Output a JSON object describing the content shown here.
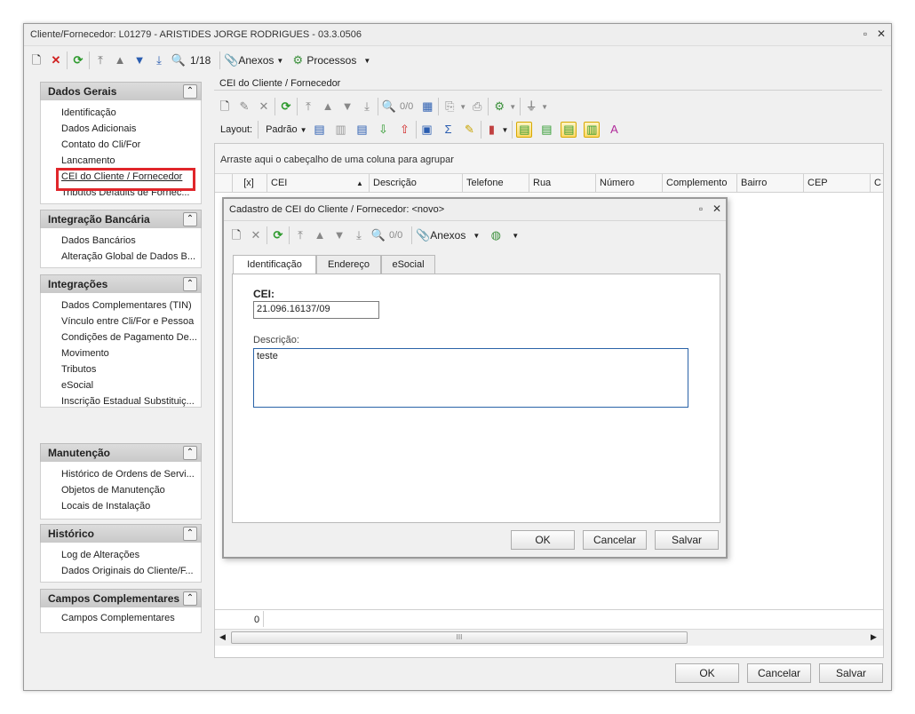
{
  "window": {
    "title": "Cliente/Fornecedor: L01279 - ARISTIDES JORGE RODRIGUES - 03.3.0506"
  },
  "main_toolbar": {
    "record_counter": "1/18",
    "attachments_label": "Anexos",
    "processes_label": "Processos"
  },
  "sidebar": {
    "panels": [
      {
        "title": "Dados Gerais",
        "items": [
          "Identificação",
          "Dados Adicionais",
          "Contato do Cli/For",
          "Lancamento",
          "CEI do Cliente / Fornecedor",
          "Tributos Defaults de Fornec..."
        ]
      },
      {
        "title": "Integração Bancária",
        "items": [
          "Dados Bancários",
          "Alteração Global de Dados B..."
        ]
      },
      {
        "title": "Integrações",
        "items": [
          "Dados Complementares (TIN)",
          "Vínculo entre Cli/For e Pessoa",
          "Condições de Pagamento De...",
          "Movimento",
          "Tributos",
          "eSocial",
          "Inscrição Estadual Substituiç..."
        ]
      },
      {
        "title": "Manutenção",
        "items": [
          "Histórico de Ordens de Servi...",
          "Objetos de Manutenção",
          "Locais de Instalação"
        ]
      },
      {
        "title": "Histórico",
        "items": [
          "Log de Alterações",
          "Dados Originais do Cliente/F..."
        ]
      },
      {
        "title": "Campos Complementares",
        "items": [
          "Campos Complementares"
        ]
      }
    ],
    "selected_item": "CEI do Cliente / Fornecedor"
  },
  "content": {
    "title": "CEI do Cliente /  Fornecedor",
    "toolbar": {
      "record_counter": "0/0"
    },
    "layout_bar": {
      "layout_label": "Layout:",
      "layout_value": "Padrão"
    },
    "group_hint": "Arraste aqui o cabeçalho de uma coluna para agrupar",
    "columns": [
      "[x]",
      "CEI",
      "Descrição",
      "Telefone",
      "Rua",
      "Número",
      "Complemento",
      "Bairro",
      "CEP",
      "C"
    ],
    "footer_count": "0",
    "scroll_thumb": "III"
  },
  "dialog": {
    "title": "Cadastro de CEI do Cliente / Fornecedor: <novo>",
    "toolbar": {
      "record_counter": "0/0",
      "attachments_label": "Anexos"
    },
    "tabs": [
      "Identificação",
      "Endereço",
      "eSocial"
    ],
    "fields": {
      "cei_label": "CEI:",
      "cei_value": "21.096.16137/09",
      "descricao_label": "Descrição:",
      "descricao_value": "teste"
    },
    "buttons": {
      "ok": "OK",
      "cancel": "Cancelar",
      "save": "Salvar"
    }
  },
  "footer_buttons": {
    "ok": "OK",
    "cancel": "Cancelar",
    "save": "Salvar"
  },
  "colors": {
    "selection_box": "#e0262b",
    "window_bg": "#f0f0f0",
    "panel_header": "#c9c9c9"
  }
}
